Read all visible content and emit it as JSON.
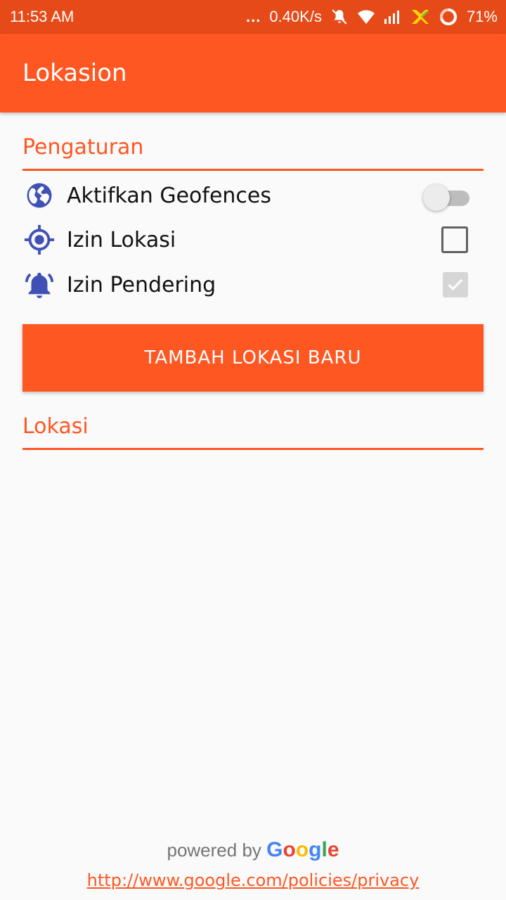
{
  "status_bar": {
    "time": "11:53 AM",
    "network_speed": "0.40K/s",
    "battery": "71%",
    "icons": [
      "more-dots-icon",
      "mute-icon",
      "wifi-icon",
      "signal-icon",
      "carrier-icon",
      "battery-ring-icon"
    ]
  },
  "app_bar": {
    "title": "Lokasion"
  },
  "settings": {
    "header": "Pengaturan",
    "items": [
      {
        "label": "Aktifkan Geofences",
        "icon": "globe-icon",
        "control": "switch",
        "checked": false
      },
      {
        "label": "Izin Lokasi",
        "icon": "location-crosshair-icon",
        "control": "checkbox",
        "checked": false
      },
      {
        "label": "Izin Pendering",
        "icon": "bell-icon",
        "control": "checkbox",
        "checked": true,
        "disabled": true
      }
    ]
  },
  "add_button": {
    "label": "TAMBAH LOKASI BARU"
  },
  "locations": {
    "header": "Lokasi",
    "items": []
  },
  "footer": {
    "powered_by": "powered by",
    "google": [
      "G",
      "o",
      "o",
      "g",
      "l",
      "e"
    ],
    "privacy_link": "http://www.google.com/policies/privacy"
  },
  "colors": {
    "primary": "#ff5722",
    "primary_dark": "#e64a19",
    "icon": "#3f51b5",
    "google_blue": "#4285f4",
    "google_red": "#ea4335",
    "google_yellow": "#fbbc05",
    "google_green": "#34a853"
  }
}
